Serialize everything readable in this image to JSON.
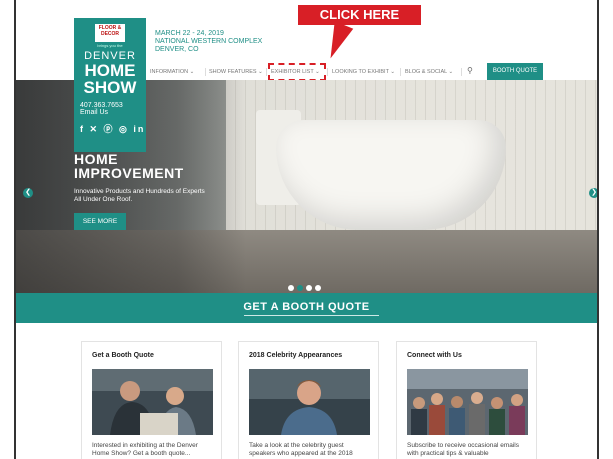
{
  "annotation": {
    "callout": "CLICK HERE"
  },
  "logo": {
    "brand": "FLOOR & DECOR",
    "tagline": "brings you the",
    "line1": "DENVER",
    "line2": "HOME",
    "line3": "SHOW",
    "phone": "407.363.7653",
    "email": "Email Us",
    "social": "f ✕ ⓟ ◎ in"
  },
  "event": {
    "dates": "MARCH 22 - 24, 2019",
    "venue": "NATIONAL WESTERN COMPLEX",
    "city": "DENVER, CO"
  },
  "nav": {
    "items": [
      {
        "label": "INFORMATION ⌄"
      },
      {
        "label": "SHOW FEATURES ⌄"
      },
      {
        "label": "EXHIBITOR LIST ⌄"
      },
      {
        "label": "LOOKING TO EXHIBIT ⌄"
      },
      {
        "label": "BLOG & SOCIAL ⌄"
      }
    ],
    "cta": "BOOTH QUOTE"
  },
  "hero": {
    "title_line1": "HOME",
    "title_line2": "IMPROVEMENT",
    "subtitle_line1": "Innovative Products and Hundreds of Experts",
    "subtitle_line2": "All Under One Roof.",
    "cta": "SEE MORE",
    "prev": "❮",
    "next": "❯",
    "slides": 4,
    "active_slide": 1
  },
  "quote_bar": {
    "label": "GET A BOOTH QUOTE"
  },
  "cards": [
    {
      "title": "Get a Booth Quote",
      "text_line1": "Interested in exhibiting at the Denver",
      "text_line2": "Home Show? Get a booth quote..."
    },
    {
      "title": "2018 Celebrity Appearances",
      "text_line1": "Take a look at the celebrity guest",
      "text_line2": "speakers who appeared at the 2018"
    },
    {
      "title": "Connect with Us",
      "text_line1": "Subscribe to receive occasional emails",
      "text_line2": "with practical tips & valuable"
    }
  ],
  "colors": {
    "teal": "#1f8f86",
    "red": "#d81f26"
  }
}
